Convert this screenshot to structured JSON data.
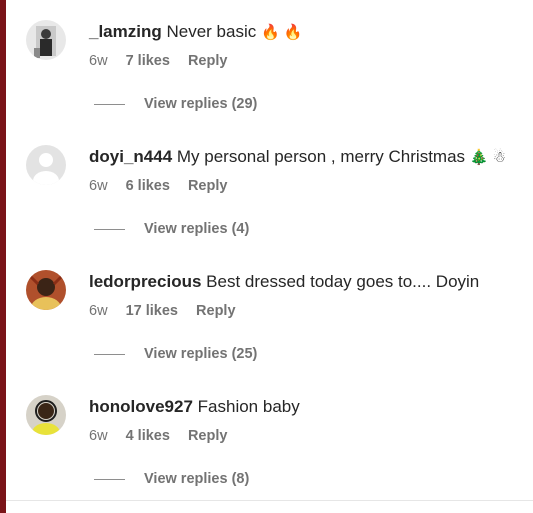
{
  "comments": [
    {
      "username": "_lamzing",
      "text": "Never basic",
      "emoji": "🔥 🔥",
      "age": "6w",
      "likes": "7 likes",
      "reply": "Reply",
      "view_replies": "View replies (29)"
    },
    {
      "username": "doyi_n444",
      "text": "My personal person , merry Christmas",
      "emoji": "🎄 ☃",
      "age": "6w",
      "likes": "6 likes",
      "reply": "Reply",
      "view_replies": "View replies (4)"
    },
    {
      "username": "ledorprecious",
      "text": "Best dressed today goes to.... Doyin",
      "emoji": "",
      "age": "6w",
      "likes": "17 likes",
      "reply": "Reply",
      "view_replies": "View replies (25)"
    },
    {
      "username": "honolove927",
      "text": "Fashion baby",
      "emoji": "",
      "age": "6w",
      "likes": "4 likes",
      "reply": "Reply",
      "view_replies": "View replies (8)"
    }
  ],
  "colors": {
    "accent_bar": "#7a1418",
    "username": "#262626",
    "meta": "#737373"
  }
}
